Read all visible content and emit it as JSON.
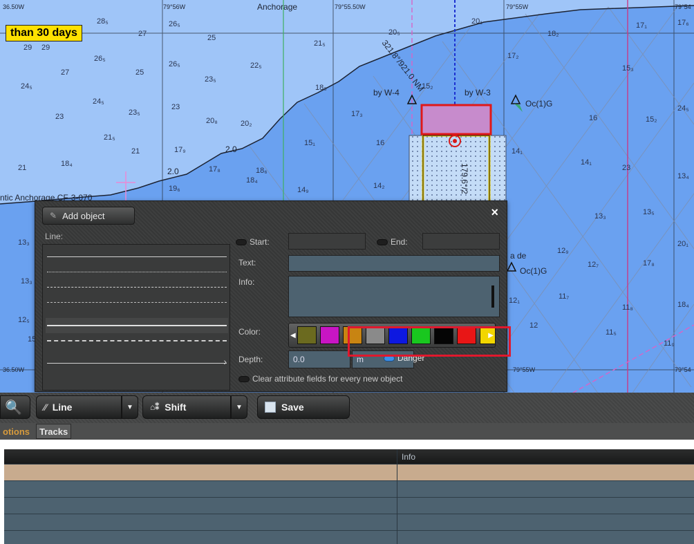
{
  "chart": {
    "notice": "than 30 days",
    "place_label": "Anchorage",
    "anchorage_label": "ntic Anchorage CF-3-070",
    "lon_labels": [
      "36.50W",
      "79°56W",
      "79°55.50W",
      "79°55W",
      "79°54",
      "36.50W",
      "79°55W",
      "79°54"
    ],
    "bearing_label": "321.8°/921.0 NM",
    "vertical_label": "179.6°/2",
    "buoy_labels": [
      "by W-4",
      "by W-3",
      "Oc(1)G",
      "Oc(1)G",
      "a de"
    ],
    "line_labels": [
      "2.0",
      "2.0"
    ],
    "depths": [
      "28₅",
      "27",
      "26₅",
      "25",
      "29",
      "29",
      "26₅",
      "27",
      "25",
      "24₅",
      "22₅",
      "23₅",
      "21₅",
      "18₅",
      "20₅",
      "20₁",
      "18₂",
      "17₁",
      "17₆",
      "26₅",
      "24₅",
      "23₅",
      "23",
      "20₈",
      "20₂",
      "17₃",
      "15₂",
      "17₂",
      "15₃",
      "16",
      "15₂",
      "24₅",
      "23",
      "21₅",
      "21",
      "17₉",
      "15₁",
      "16",
      "14₁",
      "14₁",
      "23",
      "21",
      "18₄",
      "19₆",
      "17₈",
      "18₆",
      "18₄",
      "14₉",
      "14₂",
      "13₄",
      "13₃",
      "13₅",
      "20₁",
      "13₃",
      "12₉",
      "12₇",
      "17₈",
      "13₃",
      "12₁",
      "11₇",
      "11₈",
      "18₄",
      "12₅",
      "12",
      "11₅",
      "11₉",
      "15"
    ]
  },
  "dialog": {
    "title": "Add object",
    "close": "×",
    "line_label": "Line:",
    "start_label": "Start:",
    "end_label": "End:",
    "text_label": "Text:",
    "info_label": "Info:",
    "color_label": "Color:",
    "depth_label": "Depth:",
    "depth_value": "0.0",
    "depth_unit": "m",
    "danger_label": "Danger",
    "clear_label": "Clear attribute fields for every new object",
    "colors": [
      "#6b6a1f",
      "#c815c4",
      "#c88412",
      "#8a8a8a",
      "#0d18e0",
      "#19c71f",
      "#050505",
      "#e81616",
      "#f2d600"
    ]
  },
  "toolbar": {
    "line_label": "Line",
    "shift_label": "Shift",
    "save_label": "Save"
  },
  "tabs": {
    "options": "otions",
    "tracks": "Tracks"
  },
  "table": {
    "info_header": "Info"
  }
}
